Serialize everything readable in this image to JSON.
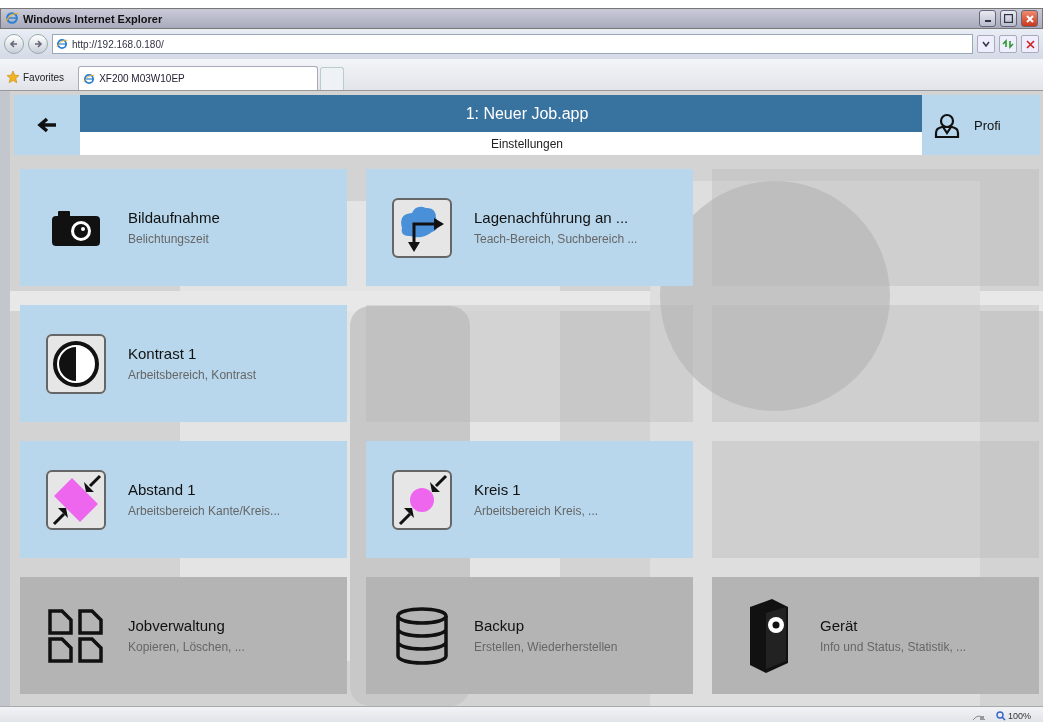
{
  "window": {
    "title": "Windows Internet Explorer"
  },
  "address_bar": {
    "value": "http://192.168.0.180/"
  },
  "favorites_bar": {
    "favorites": "Favorites",
    "tabs": [
      {
        "label": "XF200 M03W10EP",
        "selected": true
      }
    ]
  },
  "app": {
    "title": "1: Neuer Job.app",
    "subtitle": "Einstellungen",
    "profile": "Profi",
    "tiles": [
      {
        "kind": "active",
        "title": "Bildaufnahme",
        "subtitle": "Belichtungszeit"
      },
      {
        "kind": "active",
        "title": "Lagenachführung an ...",
        "subtitle": "Teach-Bereich, Suchbereich ..."
      },
      {
        "kind": "empty"
      },
      {
        "kind": "active",
        "title": "Kontrast 1",
        "subtitle": "Arbeitsbereich, Kontrast"
      },
      {
        "kind": "empty"
      },
      {
        "kind": "empty"
      },
      {
        "kind": "active",
        "title": "Abstand 1",
        "subtitle": "Arbeitsbereich Kante/Kreis..."
      },
      {
        "kind": "active",
        "title": "Kreis 1",
        "subtitle": "Arbeitsbereich Kreis, ..."
      },
      {
        "kind": "empty"
      },
      {
        "kind": "system",
        "title": "Jobverwaltung",
        "subtitle": "Kopieren, Löschen, ..."
      },
      {
        "kind": "system",
        "title": "Backup",
        "subtitle": "Erstellen, Wiederherstellen"
      },
      {
        "kind": "system",
        "title": "Gerät",
        "subtitle": "Info und Status, Statistik, ..."
      }
    ]
  },
  "status_bar": {
    "zoom": "100%"
  }
}
